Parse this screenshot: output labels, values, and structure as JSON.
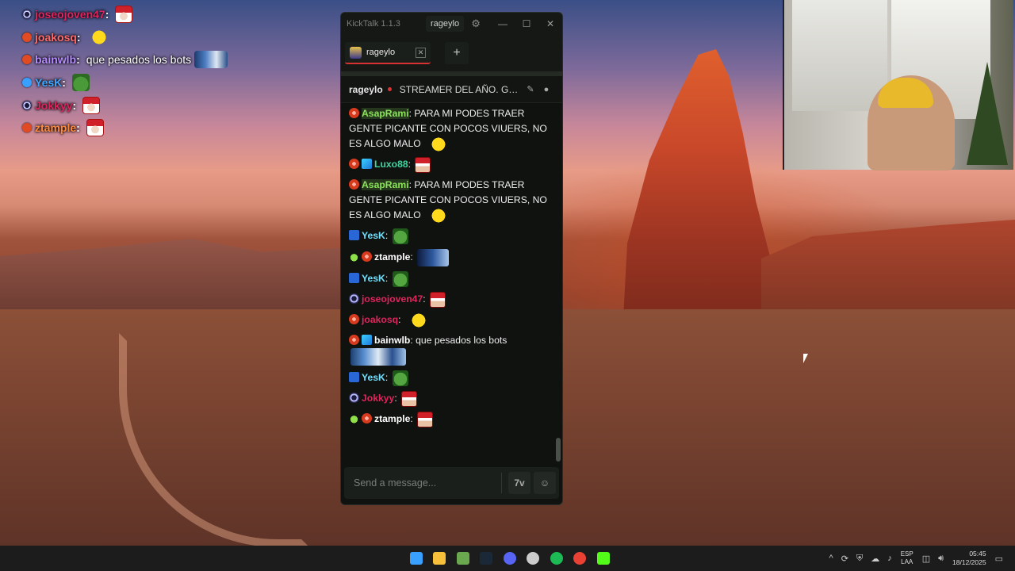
{
  "overlay_chat": [
    {
      "user": "joseojoven47",
      "user_color": "#e0245e",
      "badge": "ring",
      "message": "",
      "emote": "santa"
    },
    {
      "user": "joakosq",
      "user_color": "#ff6b6b",
      "badge": "red",
      "message": "",
      "emote": "smile"
    },
    {
      "user": "bainwlb",
      "user_color": "#b58cff",
      "badge": "red-gift",
      "message": "que pesados los bots",
      "emote": "wide"
    },
    {
      "user": "YesK",
      "user_color": "#3ea7ff",
      "badge": "sub",
      "message": "",
      "emote": "pepe"
    },
    {
      "user": "Jokkyy",
      "user_color": "#e0245e",
      "badge": "ring",
      "message": "",
      "emote": "santa"
    },
    {
      "user": "ztample",
      "user_color": "#ff8a3d",
      "badge": "red",
      "message": "",
      "emote": "santa"
    }
  ],
  "window": {
    "app_title": "KickTalk 1.1.3",
    "account": "rageylo",
    "tab_label": "rageylo",
    "channel": "rageylo",
    "stream_title": "STREAMER DEL AÑO. GANADOR NUEVO GAME",
    "composer_placeholder": "Send a message..."
  },
  "chat": [
    {
      "badges": [
        "red"
      ],
      "user": "AsapRami",
      "user_color": "#8be35a",
      "highlight": true,
      "text": "PARA MI PODES TRAER GENTE PICANTE CON POCOS VIUERS, NO ES ALGO MALO",
      "emote": "smile"
    },
    {
      "badges": [
        "red",
        "gift"
      ],
      "user": "Luxo88",
      "user_color": "#3fd6a0",
      "text": "",
      "emote": "santa"
    },
    {
      "badges": [
        "red"
      ],
      "user": "AsapRami",
      "user_color": "#8be35a",
      "highlight": true,
      "text": "PARA MI PODES TRAER GENTE PICANTE CON POCOS VIUERS, NO ES ALGO MALO",
      "emote": "smile"
    },
    {
      "badges": [
        "sub"
      ],
      "user": "YesK",
      "user_color": "#6fe0ff",
      "text": "",
      "emote": "pepe"
    },
    {
      "badges": [
        "alien",
        "red"
      ],
      "user": "ztample",
      "user_color": "#ffffff",
      "text": "",
      "emote": "block"
    },
    {
      "badges": [
        "sub"
      ],
      "user": "YesK",
      "user_color": "#6fe0ff",
      "text": "",
      "emote": "pepe"
    },
    {
      "badges": [
        "ring"
      ],
      "user": "joseojoven47",
      "user_color": "#e0245e",
      "text": "",
      "emote": "santa"
    },
    {
      "badges": [
        "red"
      ],
      "user": "joakosq",
      "user_color": "#e0245e",
      "text": "",
      "emote": "smile"
    },
    {
      "badges": [
        "red",
        "gift"
      ],
      "user": "bainwlb",
      "user_color": "#ffffff",
      "text": "que pesados los bots",
      "emote": "wide"
    },
    {
      "badges": [
        "sub"
      ],
      "user": "YesK",
      "user_color": "#6fe0ff",
      "text": "",
      "emote": "pepe"
    },
    {
      "badges": [
        "ring"
      ],
      "user": "Jokkyy",
      "user_color": "#e0245e",
      "text": "",
      "emote": "santa"
    },
    {
      "badges": [
        "alien",
        "red"
      ],
      "user": "ztample",
      "user_color": "#ffffff",
      "text": "",
      "emote": "santa"
    }
  ],
  "taskbar": {
    "apps": [
      "start-icon",
      "file-explorer-icon",
      "minecraft-icon",
      "steam-icon",
      "discord-icon",
      "obs-icon",
      "spotify-icon",
      "chrome-icon",
      "kick-icon"
    ],
    "app_colors": [
      "#3aa0ff",
      "#f6c03a",
      "#6aa84f",
      "#1b2838",
      "#5865f2",
      "#cccccc",
      "#1db954",
      "#e94235",
      "#53fc18"
    ],
    "lang_top": "ESP",
    "lang_bottom": "LAA",
    "time": "05:45",
    "date": "18/12/2025"
  }
}
